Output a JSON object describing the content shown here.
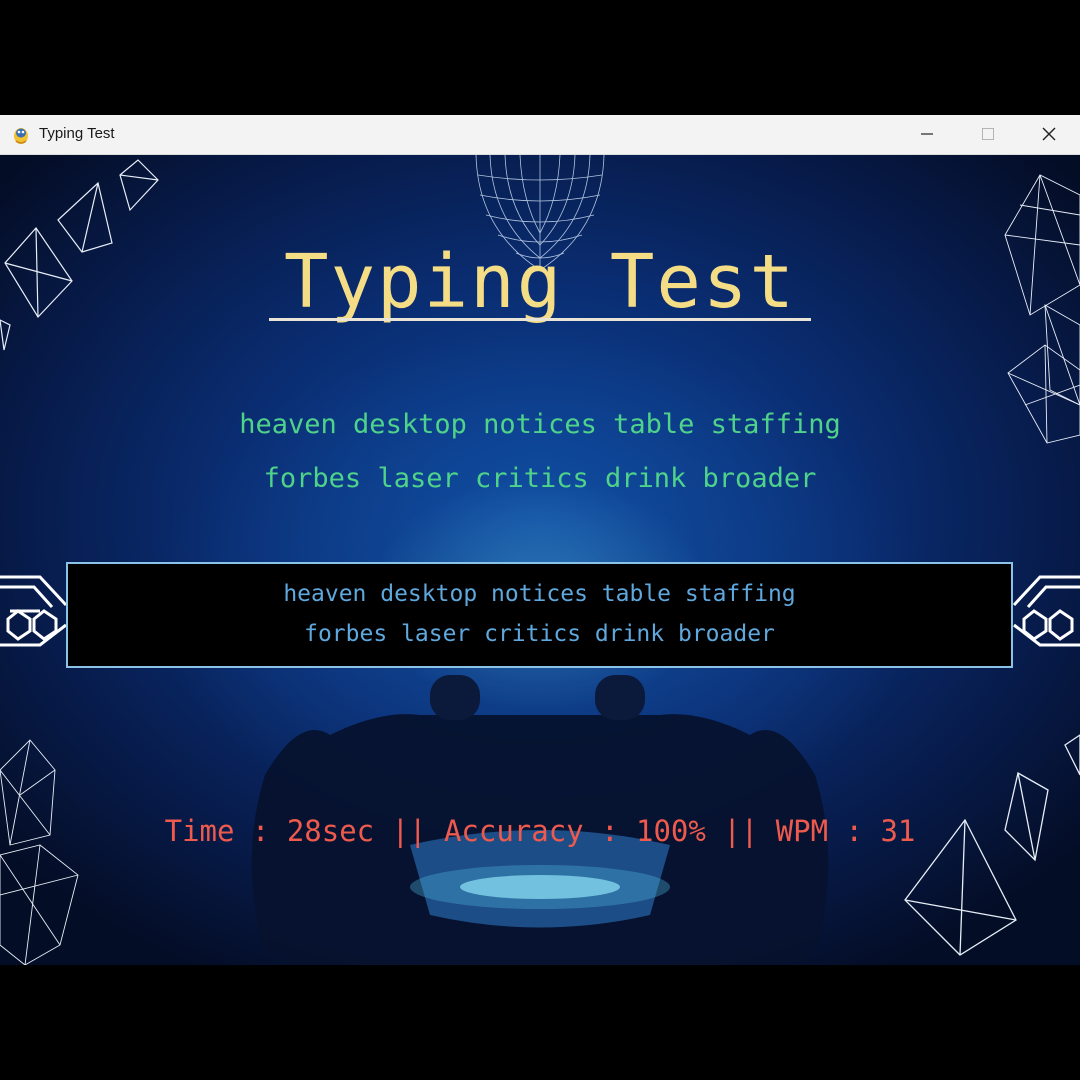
{
  "window": {
    "title": "Typing Test",
    "icons": {
      "app": "pygame-snake-icon",
      "minimize": "minimize-icon",
      "maximize": "maximize-icon",
      "close": "close-icon"
    }
  },
  "game": {
    "heading": "Typing Test",
    "prompt_lines": [
      "heaven desktop notices table staffing",
      "forbes laser critics drink broader"
    ],
    "typed_lines": [
      "heaven desktop notices table staffing",
      "forbes laser critics drink broader"
    ],
    "stats": {
      "text": "Time : 28sec || Accuracy : 100% || WPM : 31",
      "time": "28sec",
      "accuracy": "100%",
      "wpm": "31"
    }
  },
  "colors": {
    "heading": "#f5dd86",
    "prompt": "#4fd38a",
    "typed": "#5fa8de",
    "stats": "#ee5a4d",
    "input_border": "#8bc2e8"
  }
}
